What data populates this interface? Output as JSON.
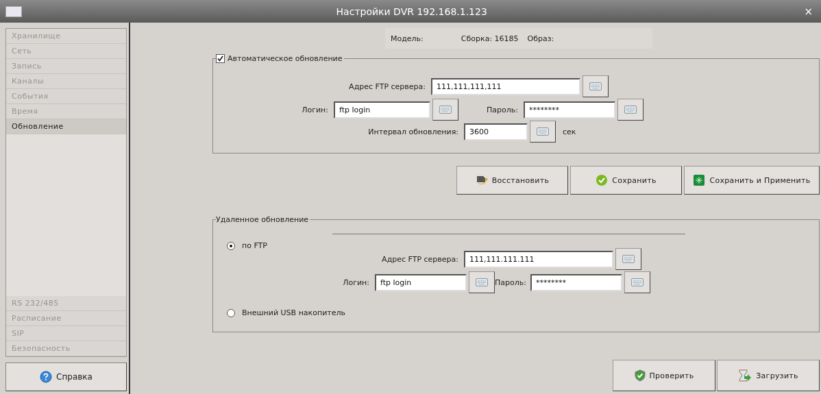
{
  "window": {
    "title": "Настройки DVR 192.168.1.123",
    "close": "×"
  },
  "sidebar": {
    "top_items": [
      {
        "label": "Хранилище",
        "selected": false
      },
      {
        "label": "Сеть",
        "selected": false
      },
      {
        "label": "Запись",
        "selected": false
      },
      {
        "label": "Каналы",
        "selected": false
      },
      {
        "label": "События",
        "selected": false
      },
      {
        "label": "Время",
        "selected": false
      },
      {
        "label": "Обновление",
        "selected": true
      }
    ],
    "bottom_items": [
      {
        "label": "RS 232/485",
        "selected": false
      },
      {
        "label": "Расписание",
        "selected": false
      },
      {
        "label": "SIP",
        "selected": false
      },
      {
        "label": "Безопасность",
        "selected": false
      }
    ],
    "help_button": "Справка"
  },
  "info": {
    "model": "Модель:",
    "build": "Сборка: 16185",
    "image": "Образ:"
  },
  "auto_update": {
    "title": "Автоматическое обновление",
    "checked": true,
    "ftp_label": "Адрес FTP сервера:",
    "ftp_value": "111,111,111,111",
    "login_label": "Логин:",
    "login_value": "ftp login",
    "password_label": "Пароль:",
    "password_value": "********",
    "interval_label": "Интервал обновления:",
    "interval_value": "3600",
    "interval_unit": "сек"
  },
  "actions": [
    {
      "label": "Восстановить",
      "kind": "restore"
    },
    {
      "label": "Сохранить",
      "kind": "save"
    },
    {
      "label": "Сохранить и Применить",
      "kind": "apply"
    }
  ],
  "remote_update": {
    "title": "Удаленное обновление",
    "options": [
      {
        "label": "по FTP",
        "selected": true
      },
      {
        "label": "Внешний USB накопитель",
        "selected": false
      }
    ],
    "ftp_label": "Адрес FTP сервера:",
    "ftp_value": "111,111.111.111",
    "login_label": "Логин:",
    "login_value": "ftp login",
    "password_label": "Пароль:",
    "password_value": "********"
  },
  "bottom_buttons": [
    {
      "label": "Проверить",
      "kind": "check"
    },
    {
      "label": "Загрузить",
      "kind": "load"
    }
  ]
}
